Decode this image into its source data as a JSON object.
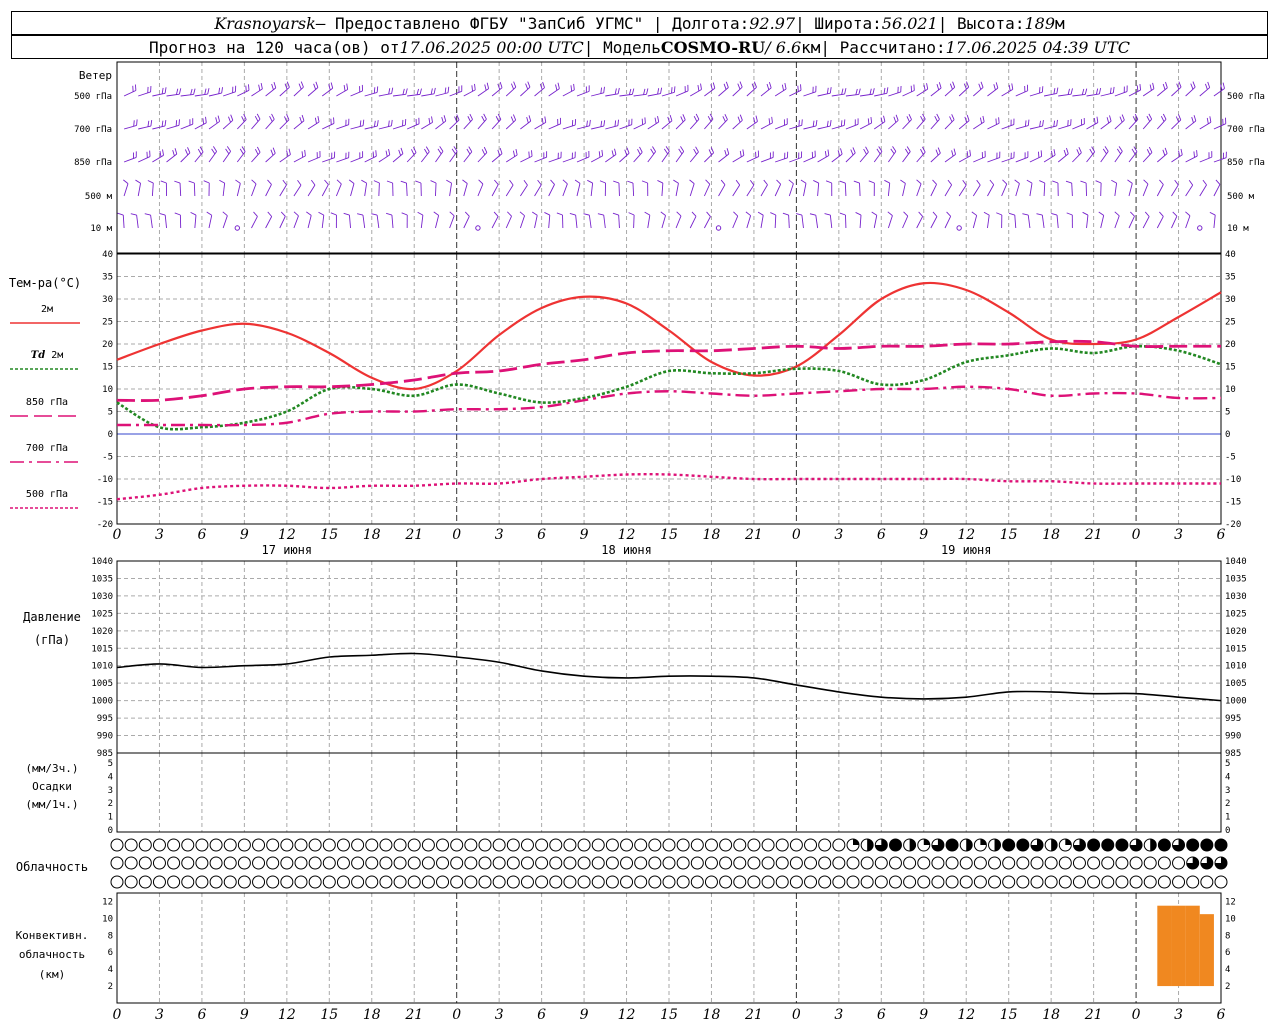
{
  "header": {
    "city": "Krasnoyarsk",
    "provider": " — Предоставлено ФГБУ \"ЗапСиб УГМС\" | Долгота: ",
    "lon": "92.97",
    "lat_label": " | Широта: ",
    "lat": "56.021",
    "alt_label": " | Высота: ",
    "alt": "189",
    "alt_unit": "м",
    "forecast_label": "Прогноз на 120 часа(ов) от ",
    "forecast_start": "17.06.2025 00:00 UTC",
    "model_label": "  | Модель ",
    "model": "COSMO-RU",
    "resolution": " / 6.6",
    "res_unit": "км",
    "calc_label": " | Рассчитано: ",
    "calc_time": "17.06.2025 04:39 UTC"
  },
  "wind_panel": {
    "title": "Ветер",
    "levels": [
      "500 гПа",
      "700 гПа",
      "850 гПа",
      "500 м",
      "10 м"
    ]
  },
  "temp_panel": {
    "title": "Тем-ра(°C)",
    "legend": [
      {
        "label": "2м",
        "color": "#ee3333",
        "dash": "solid"
      },
      {
        "label_it": "Td",
        "label": " 2м",
        "color": "#228822",
        "dash": "dot"
      },
      {
        "label": "850 гПа",
        "color": "#dd1177",
        "dash": "long"
      },
      {
        "label": "700 гПа",
        "color": "#dd1177",
        "dash": "dashdot"
      },
      {
        "label": "500 гПа",
        "color": "#dd1177",
        "dash": "dot"
      }
    ],
    "yticks": [
      40,
      35,
      30,
      25,
      20,
      15,
      10,
      5,
      0,
      -5,
      -10,
      -15,
      -20
    ]
  },
  "pressure_panel": {
    "title1": "Давление",
    "title2": "(гПа)",
    "yticks": [
      1040,
      1035,
      1030,
      1025,
      1020,
      1015,
      1010,
      1005,
      1000,
      995,
      990,
      985
    ]
  },
  "precip_panel": {
    "title1": "(мм/3ч.)",
    "title2": "Осадки",
    "title3": "(мм/1ч.)",
    "yticks": [
      5,
      4,
      3,
      2,
      1,
      0
    ]
  },
  "cloud_panel": {
    "title": "Облачность"
  },
  "conv_panel": {
    "title1": "Конвективн.",
    "title2": "облачность",
    "title3": "(км)",
    "yticks": [
      12,
      10,
      8,
      6,
      4,
      2
    ]
  },
  "xaxis": {
    "hour_labels": [
      "0",
      "3",
      "6",
      "9",
      "12",
      "15",
      "18",
      "21",
      "0",
      "3",
      "6",
      "9",
      "12",
      "15",
      "18",
      "21",
      "0",
      "3",
      "6",
      "9",
      "12",
      "15",
      "18",
      "21",
      "0",
      "3",
      "6"
    ],
    "day_labels": [
      {
        "hour": 12,
        "label": "17 июня"
      },
      {
        "hour": 36,
        "label": "18 июня"
      },
      {
        "hour": 60,
        "label": "19 июня"
      }
    ]
  },
  "chart_data": {
    "type": "line",
    "x_hours": [
      0,
      3,
      6,
      9,
      12,
      15,
      18,
      21,
      24,
      27,
      30,
      33,
      36,
      39,
      42,
      45,
      48,
      51,
      54,
      57,
      60,
      63,
      66,
      69,
      72,
      75,
      78
    ],
    "series": [
      {
        "name": "2м",
        "color": "#ee3333",
        "values": [
          16.5,
          20,
          23,
          24.5,
          22.5,
          18,
          12.5,
          10,
          14,
          22,
          28,
          30.5,
          29,
          23,
          16,
          13,
          15,
          22,
          30,
          33.5,
          32,
          27,
          21,
          20,
          21,
          26,
          31.5
        ]
      },
      {
        "name": "Td 2м",
        "color": "#228822",
        "values": [
          7,
          1.5,
          1.5,
          2.5,
          5,
          10,
          10,
          8.5,
          11,
          9,
          7,
          8,
          10.5,
          14,
          13.5,
          13.5,
          14.5,
          14,
          11,
          12,
          16,
          17.5,
          19,
          18,
          19.5,
          18.5,
          15.5
        ]
      },
      {
        "name": "850 гПа",
        "color": "#dd1177",
        "values": [
          7.5,
          7.5,
          8.5,
          10,
          10.5,
          10.5,
          11,
          12,
          13.5,
          14,
          15.5,
          16.5,
          18,
          18.5,
          18.5,
          19,
          19.5,
          19,
          19.5,
          19.5,
          20,
          20,
          20.5,
          20.5,
          19.5,
          19.5,
          19.5
        ]
      },
      {
        "name": "700 гПа",
        "color": "#dd1177",
        "values": [
          2,
          2,
          2,
          2,
          2.5,
          4.5,
          5,
          5,
          5.5,
          5.5,
          6,
          7.5,
          9,
          9.5,
          9,
          8.5,
          9,
          9.5,
          10,
          10,
          10.5,
          10,
          8.5,
          9,
          9,
          8,
          8
        ]
      },
      {
        "name": "500 гПа",
        "color": "#dd1177",
        "values": [
          -14.5,
          -13.5,
          -12,
          -11.5,
          -11.5,
          -12,
          -11.5,
          -11.5,
          -11,
          -11,
          -10,
          -9.5,
          -9,
          -9,
          -9.5,
          -10,
          -10,
          -10,
          -10,
          -10,
          -10,
          -10.5,
          -10.5,
          -11,
          -11,
          -11,
          -11
        ]
      }
    ],
    "pressure": {
      "name": "Давление",
      "color": "#000000",
      "values": [
        1009.5,
        1010.5,
        1009.5,
        1010,
        1010.5,
        1012.5,
        1013,
        1013.5,
        1012.5,
        1011,
        1008.5,
        1007,
        1006.5,
        1007,
        1007,
        1006.5,
        1004.5,
        1002.5,
        1001,
        1000.5,
        1001,
        1002.5,
        1002.5,
        1002,
        1002,
        1001,
        1000
      ]
    },
    "convective_cloud": {
      "name": "Конвективная облачность",
      "color": "#f08820",
      "bars": [
        {
          "hour": 74,
          "base": 2,
          "top": 11.5
        },
        {
          "hour": 75,
          "base": 2,
          "top": 11.5
        },
        {
          "hour": 76,
          "base": 2,
          "top": 11.5
        },
        {
          "hour": 77,
          "base": 2,
          "top": 10.5
        }
      ]
    },
    "ylim_temp": [
      -20,
      40
    ],
    "ylim_pressure": [
      985,
      1040
    ],
    "ylim_precip": [
      0,
      5
    ],
    "ylim_conv": [
      0,
      13
    ],
    "xlim": [
      0,
      78
    ]
  }
}
